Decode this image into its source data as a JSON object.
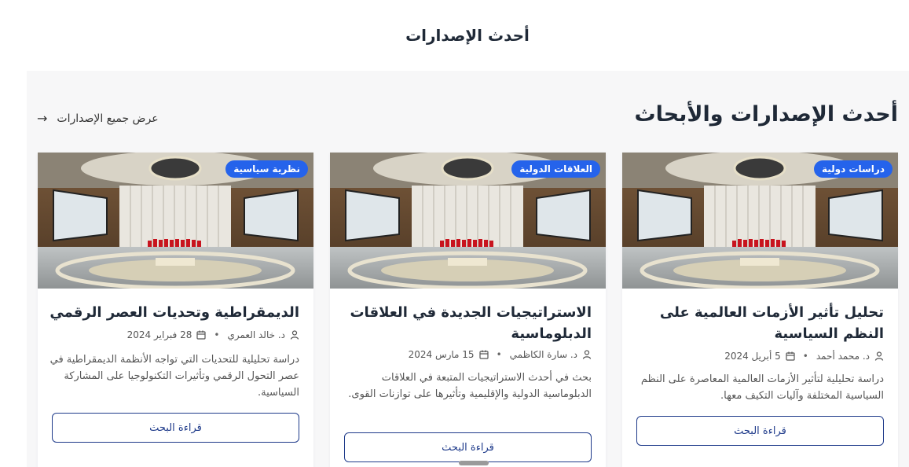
{
  "page_heading": "أحدث الإصدارات",
  "section": {
    "title": "أحدث الإصدارات والأبحاث",
    "view_all": "عرض جميع الإصدارات",
    "view_all_arrow": "→"
  },
  "cards": [
    {
      "badge": "دراسات دولية",
      "title": "تحليل تأثير الأزمات العالمية على النظم السياسية",
      "author": "د. محمد أحمد",
      "date": "5 أبريل 2024",
      "description": "دراسة تحليلية لتأثير الأزمات العالمية المعاصرة على النظم السياسية المختلفة وآليات التكيف معها.",
      "button": "قراءة البحث"
    },
    {
      "badge": "العلاقات الدولية",
      "title": "الاستراتيجيات الجديدة في العلاقات الدبلوماسية",
      "author": "د. سارة الكاظمي",
      "date": "15 مارس 2024",
      "description": "بحث في أحدث الاستراتيجيات المتبعة في العلاقات الدبلوماسية الدولية والإقليمية وتأثيرها على توازنات القوى.",
      "button": "قراءة البحث"
    },
    {
      "badge": "نظرية سياسية",
      "title": "الديمقراطية وتحديات العصر الرقمي",
      "author": "د. خالد العمري",
      "date": "28 فبراير 2024",
      "description": "دراسة تحليلية للتحديات التي تواجه الأنظمة الديمقراطية في عصر التحول الرقمي وتأثيرات التكنولوجيا على المشاركة السياسية.",
      "button": "قراءة البحث"
    }
  ],
  "colors": {
    "accent": "#2563eb",
    "button_border": "#1e3a8a",
    "section_bg": "#f7f7f8"
  },
  "icons": {
    "author": "user-icon",
    "date": "calendar-icon"
  }
}
